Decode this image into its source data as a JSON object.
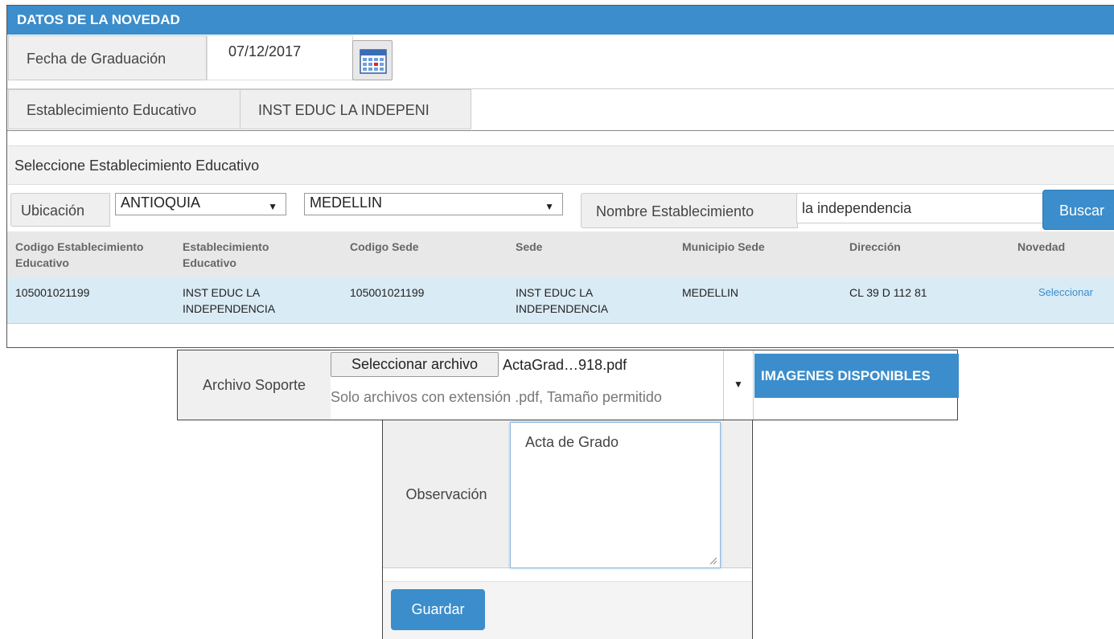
{
  "header": {
    "title": "DATOS DE LA NOVEDAD"
  },
  "fecha": {
    "label": "Fecha de Graduación",
    "value": "07/12/2017",
    "calendar_icon": "calendar-icon"
  },
  "establecimiento": {
    "label": "Establecimiento Educativo",
    "value": "INST EDUC LA INDEPENI"
  },
  "seleccion": {
    "title": "Seleccione Establecimiento Educativo",
    "ubicacion_label": "Ubicación",
    "departamento": "ANTIOQUIA",
    "municipio": "MEDELLIN",
    "nombre_label": "Nombre Establecimiento",
    "nombre_value": "la independencia",
    "buscar_label": "Buscar"
  },
  "table": {
    "columns": [
      "Codigo Establecimiento Educativo",
      "Establecimiento Educativo",
      "Codigo Sede",
      "Sede",
      "Municipio Sede",
      "Dirección",
      "Novedad"
    ],
    "rows": [
      [
        "105001021199",
        "INST EDUC LA INDEPENDENCIA",
        "105001021199",
        "INST EDUC LA INDEPENDENCIA",
        "MEDELLIN",
        "CL 39 D 112 81",
        "Seleccionar"
      ]
    ]
  },
  "archivo": {
    "label": "Archivo Soporte",
    "button_label": "Seleccionar archivo",
    "file_name": "ActaGrad…918.pdf",
    "hint": "Solo archivos con extensión .pdf, Tamaño permitido",
    "imagenes_label": "IMAGENES DISPONIBLES"
  },
  "observacion": {
    "label": "Observación",
    "value": "Acta de Grado"
  },
  "guardar_label": "Guardar",
  "colors": {
    "accent": "#3c8dcb",
    "row_highlight": "#d9ebf5",
    "label_bg": "#efefef"
  }
}
